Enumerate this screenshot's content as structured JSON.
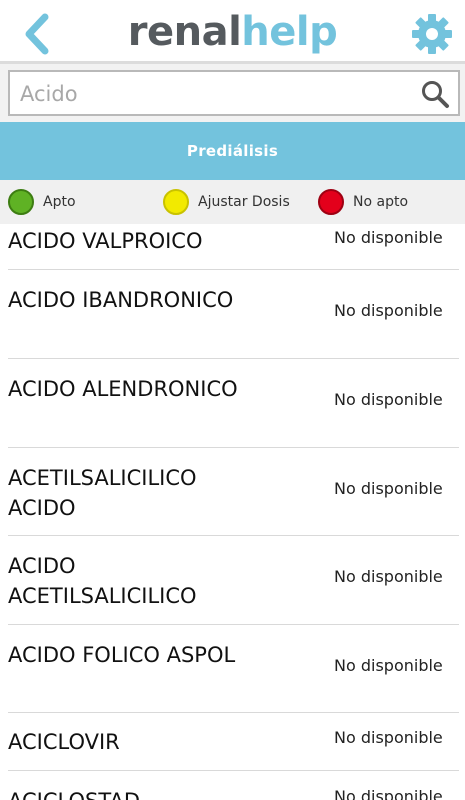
{
  "header": {
    "logo_part1": "renal",
    "logo_part2": "help",
    "back_icon": "chevron-left-icon",
    "settings_icon": "gear-icon",
    "accent_color": "#73c3dd"
  },
  "search": {
    "value": "",
    "placeholder": "Acido",
    "icon": "search-icon"
  },
  "tab": {
    "label": "Prediálisis"
  },
  "legend": [
    {
      "label": "Apto",
      "color": "#5fb224"
    },
    {
      "label": "Ajustar Dosis",
      "color": "#f2ea00"
    },
    {
      "label": "No apto",
      "color": "#e3001b"
    }
  ],
  "drugs": [
    {
      "name": "ACIDO VALPROICO",
      "status": "No disponible"
    },
    {
      "name": "ACIDO IBANDRONICO",
      "status": "No disponible"
    },
    {
      "name": "ACIDO ALENDRONICO",
      "status": "No disponible"
    },
    {
      "name": "ACETILSALICILICO ACIDO",
      "status": "No disponible"
    },
    {
      "name": "ACIDO ACETILSALICILICO",
      "status": "No disponible"
    },
    {
      "name": "ACIDO FOLICO ASPOL",
      "status": "No disponible"
    },
    {
      "name": "ACICLOVIR",
      "status": "No disponible"
    },
    {
      "name": "ACICLOSTAD",
      "status": "No disponible"
    }
  ]
}
